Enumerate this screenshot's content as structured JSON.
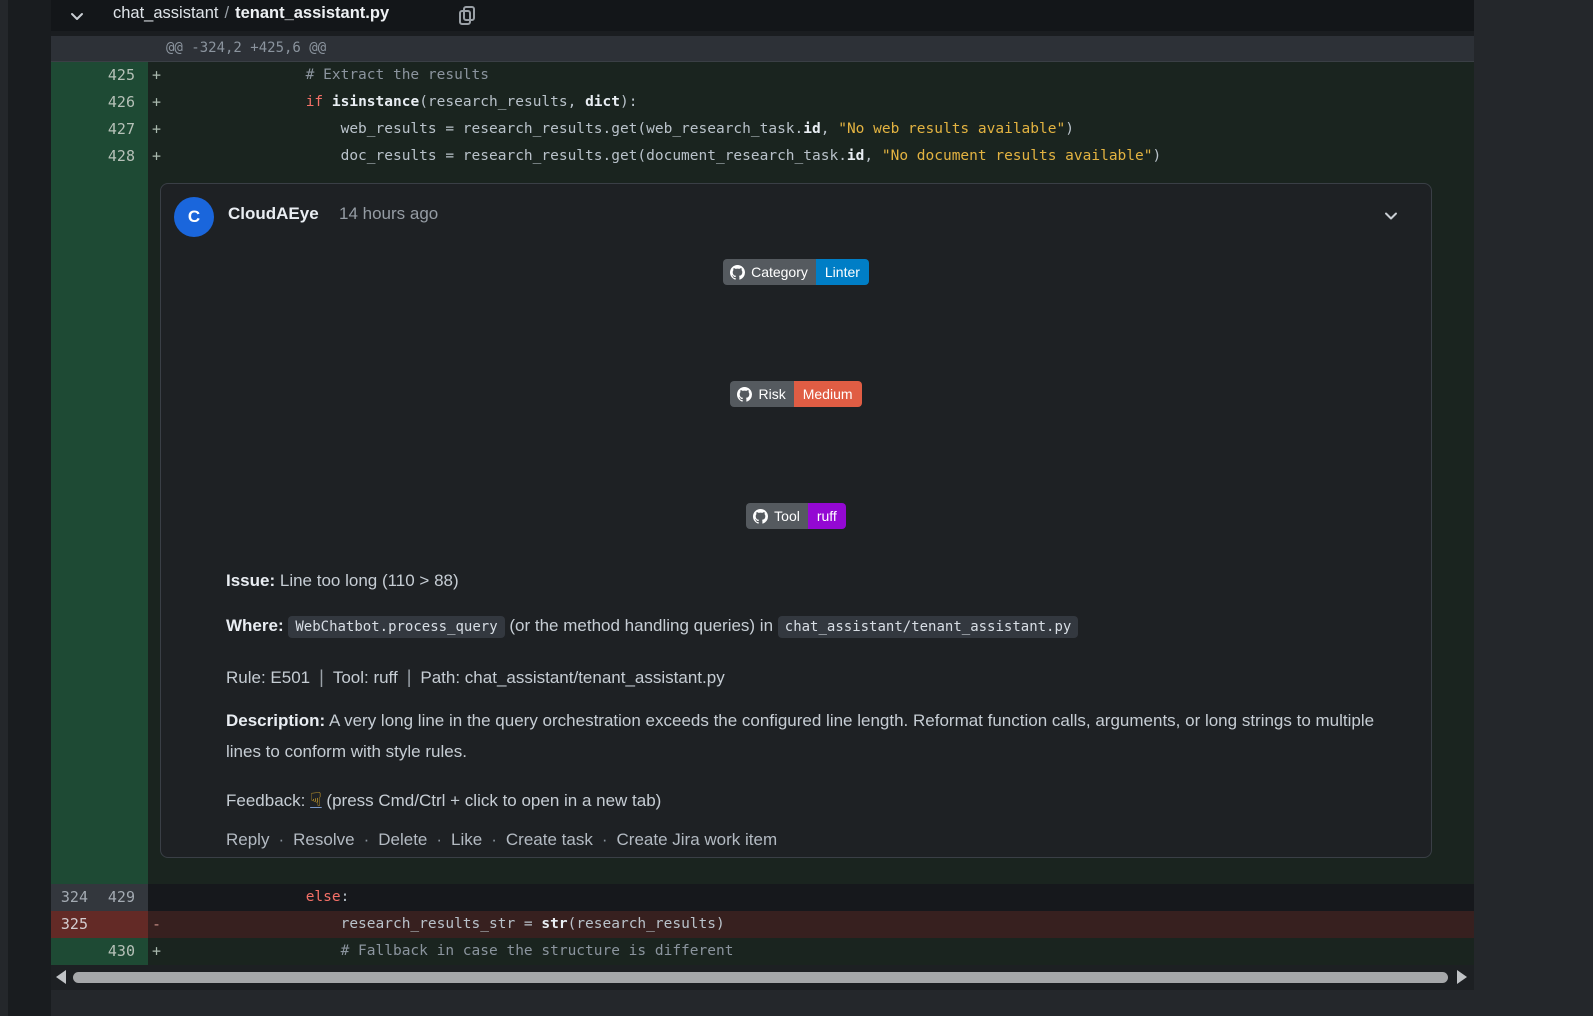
{
  "file_header": {
    "dir": "chat_assistant",
    "separator": "/",
    "file": "tenant_assistant.py"
  },
  "hunk_header": "@@ -324,2 +425,6 @@",
  "diff": {
    "rows_top": [
      {
        "old": "",
        "new": "425",
        "marker": "+",
        "type": "add",
        "tokens": [
          {
            "c": "com",
            "t": "                # Extract the results"
          }
        ]
      },
      {
        "old": "",
        "new": "426",
        "marker": "+",
        "type": "add",
        "tokens": [
          {
            "c": "pln",
            "t": "                "
          },
          {
            "c": "kw",
            "t": "if"
          },
          {
            "c": "pln",
            "t": " "
          },
          {
            "c": "b",
            "t": "isinstance"
          },
          {
            "c": "pln",
            "t": "(research_results, "
          },
          {
            "c": "b",
            "t": "dict"
          },
          {
            "c": "pln",
            "t": "):"
          }
        ]
      },
      {
        "old": "",
        "new": "427",
        "marker": "+",
        "type": "add",
        "tokens": [
          {
            "c": "pln",
            "t": "                    web_results = research_results.get(web_research_task."
          },
          {
            "c": "b",
            "t": "id"
          },
          {
            "c": "pln",
            "t": ", "
          },
          {
            "c": "str",
            "t": "\"No web results available\""
          },
          {
            "c": "pln",
            "t": ")"
          }
        ]
      },
      {
        "old": "",
        "new": "428",
        "marker": "+",
        "type": "add",
        "tokens": [
          {
            "c": "pln",
            "t": "                    doc_results = research_results.get(document_research_task."
          },
          {
            "c": "b",
            "t": "id"
          },
          {
            "c": "pln",
            "t": ", "
          },
          {
            "c": "str",
            "t": "\"No document results available\""
          },
          {
            "c": "pln",
            "t": ")"
          }
        ]
      }
    ],
    "rows_bottom": [
      {
        "old": "324",
        "new": "429",
        "marker": "",
        "type": "ctx",
        "tokens": [
          {
            "c": "pln",
            "t": "                "
          },
          {
            "c": "kw",
            "t": "else"
          },
          {
            "c": "pln",
            "t": ":"
          }
        ]
      },
      {
        "old": "325",
        "new": "",
        "marker": "-",
        "type": "del",
        "tokens": [
          {
            "c": "pln",
            "t": "                    research_results_str = "
          },
          {
            "c": "b",
            "t": "str"
          },
          {
            "c": "pln",
            "t": "(research_results)"
          }
        ]
      },
      {
        "old": "",
        "new": "430",
        "marker": "+",
        "type": "add",
        "tokens": [
          {
            "c": "com",
            "t": "                    # Fallback in case the structure is different"
          }
        ]
      }
    ]
  },
  "comment": {
    "avatar_letter": "C",
    "avatar_color": "#1a66dc",
    "author": "CloudAEye",
    "timestamp": "14 hours ago",
    "badges": [
      {
        "label": "Category",
        "value": "Linter",
        "color": "#007ec6"
      },
      {
        "label": "Risk",
        "value": "Medium",
        "color": "#e05d44"
      },
      {
        "label": "Tool",
        "value": "ruff",
        "color": "#9408d3"
      }
    ],
    "issue_label": "Issue:",
    "issue_text": " Line too long (110 > 88)",
    "where_label": "Where:",
    "where_code1": "WebChatbot.process_query",
    "where_mid": " (or the method handling queries) in ",
    "where_code2": "chat_assistant/tenant_assistant.py",
    "rule_text": "Rule: E501",
    "tool_text": "Tool: ruff",
    "path_text": "Path: chat_assistant/tenant_assistant.py",
    "rule_separator": "|",
    "description_label": "Description:",
    "description_text": " A very long line in the query orchestration exceeds the configured line length. Reformat function calls, arguments, or long strings to multiple lines to conform with style rules.",
    "feedback_label": "Feedback: ",
    "feedback_emoji": "☟",
    "feedback_suffix": " (press Cmd/Ctrl + click to open in a new tab)",
    "actions": [
      "Reply",
      "Resolve",
      "Delete",
      "Like",
      "Create task",
      "Create Jira work item"
    ],
    "action_separator": "·"
  }
}
